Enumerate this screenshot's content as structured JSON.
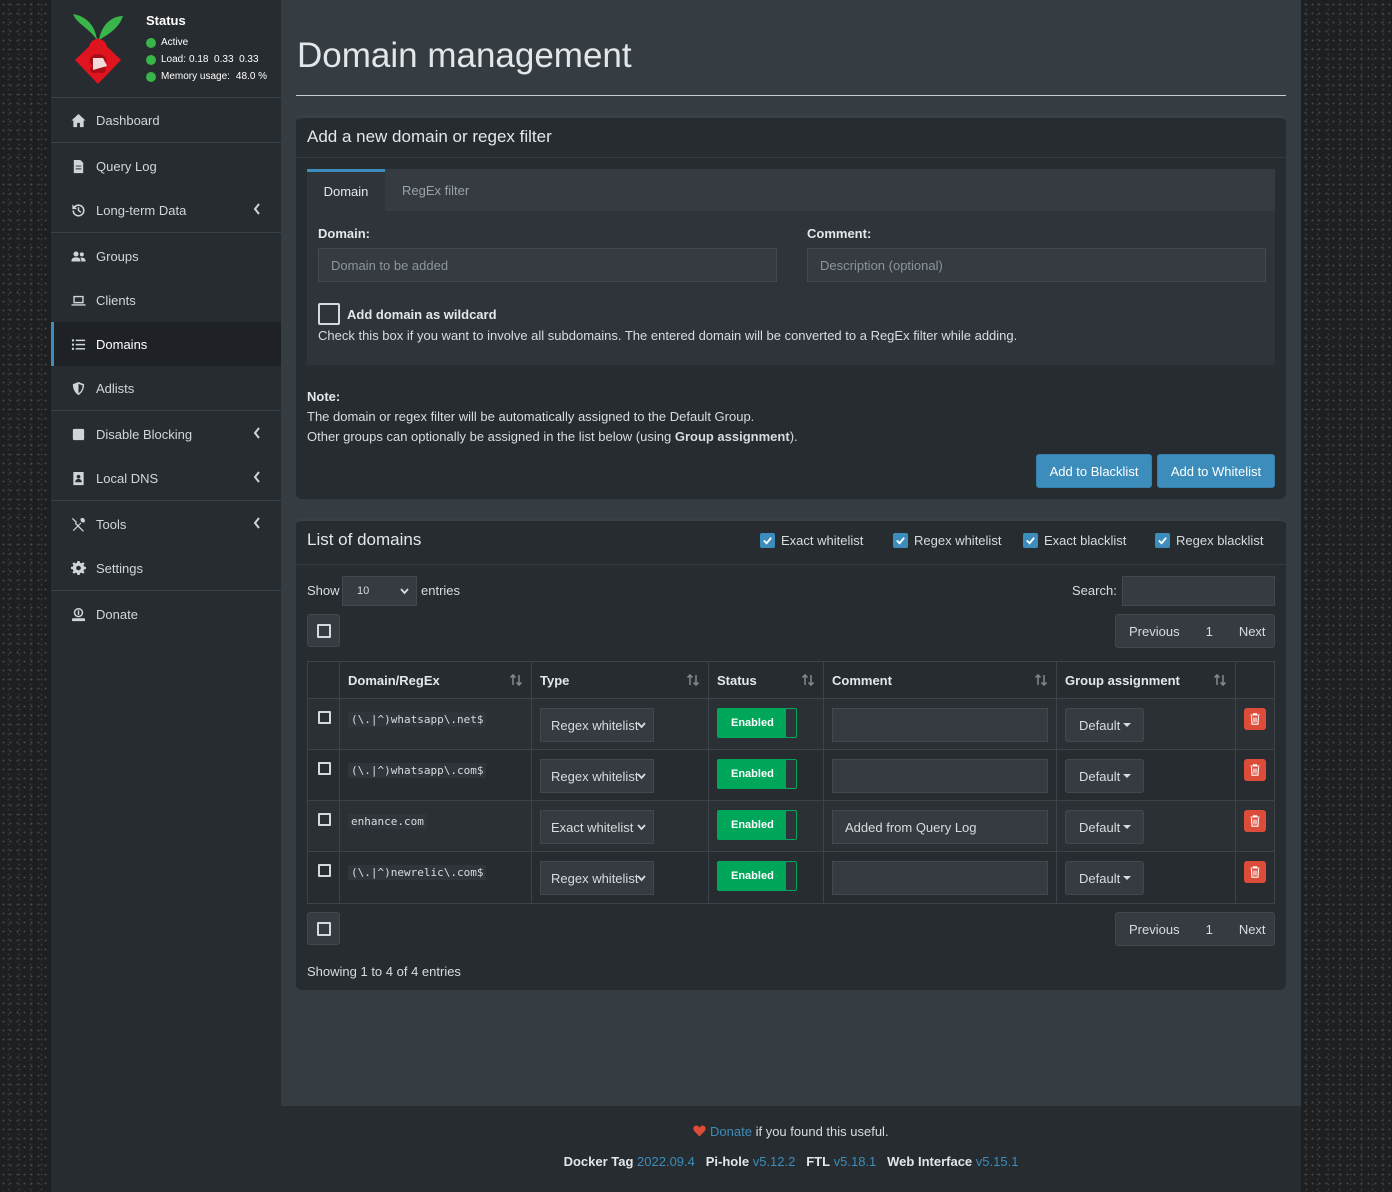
{
  "status": {
    "title": "Status",
    "active": "Active",
    "load_label": "Load:",
    "load_values": "0.18  0.33  0.33",
    "memory_label": "Memory usage:",
    "memory_value": "48.0 %"
  },
  "sidebar": {
    "items": [
      {
        "label": "Dashboard",
        "icon": "home-icon"
      },
      {
        "label": "Query Log",
        "icon": "file-icon"
      },
      {
        "label": "Long-term Data",
        "icon": "history-icon"
      },
      {
        "label": "Groups",
        "icon": "users-icon"
      },
      {
        "label": "Clients",
        "icon": "laptop-icon"
      },
      {
        "label": "Domains",
        "icon": "list-icon"
      },
      {
        "label": "Adlists",
        "icon": "shield-icon"
      },
      {
        "label": "Disable Blocking",
        "icon": "stop-icon"
      },
      {
        "label": "Local DNS",
        "icon": "address-book-icon"
      },
      {
        "label": "Tools",
        "icon": "tools-icon"
      },
      {
        "label": "Settings",
        "icon": "gear-icon"
      },
      {
        "label": "Donate",
        "icon": "donate-icon"
      }
    ],
    "active": "Domains"
  },
  "page": {
    "title": "Domain management"
  },
  "add_box": {
    "title": "Add a new domain or regex filter",
    "tabs": [
      "Domain",
      "RegEx filter"
    ],
    "domain_label": "Domain:",
    "domain_placeholder": "Domain to be added",
    "comment_label": "Comment:",
    "comment_placeholder": "Description (optional)",
    "wildcard_label": "Add domain as wildcard",
    "wildcard_help": "Check this box if you want to involve all subdomains. The entered domain will be converted to a RegEx filter while adding.",
    "note_title": "Note:",
    "note_line1": "The domain or regex filter will be automatically assigned to the Default Group.",
    "note_line2_pre": "Other groups can optionally be assigned in the list below (using ",
    "note_line2_bold": "Group assignment",
    "note_line2_post": ").",
    "blacklist_button": "Add to Blacklist",
    "whitelist_button": "Add to Whitelist"
  },
  "list_box": {
    "title": "List of domains",
    "filters": [
      "Exact whitelist",
      "Regex whitelist",
      "Exact blacklist",
      "Regex blacklist"
    ],
    "show_label": "Show",
    "entries_value": "10",
    "entries_label": "entries",
    "search_label": "Search:",
    "pager": {
      "previous": "Previous",
      "page": "1",
      "next": "Next"
    },
    "columns": [
      "Domain/RegEx",
      "Type",
      "Status",
      "Comment",
      "Group assignment"
    ],
    "rows": [
      {
        "domain": "(\\.|^)whatsapp\\.net$",
        "type": "Regex whitelist",
        "status": "Enabled",
        "comment": "",
        "group": "Default"
      },
      {
        "domain": "(\\.|^)whatsapp\\.com$",
        "type": "Regex whitelist",
        "status": "Enabled",
        "comment": "",
        "group": "Default"
      },
      {
        "domain": "enhance.com",
        "type": "Exact whitelist",
        "status": "Enabled",
        "comment": "Added from Query Log",
        "group": "Default"
      },
      {
        "domain": "(\\.|^)newrelic\\.com$",
        "type": "Regex whitelist",
        "status": "Enabled",
        "comment": "",
        "group": "Default"
      }
    ],
    "showing": "Showing 1 to 4 of 4 entries"
  },
  "footer": {
    "donate_link": "Donate",
    "donate_text": " if you found this useful.",
    "docker_label": "Docker Tag",
    "docker_value": "2022.09.4",
    "pihole_label": "Pi-hole",
    "pihole_value": "v5.12.2",
    "ftl_label": "FTL",
    "ftl_value": "v5.18.1",
    "web_label": "Web Interface",
    "web_value": "v5.15.1"
  },
  "colors": {
    "accent": "#3c8dbc",
    "success": "#00a65a",
    "danger": "#dd4b39"
  }
}
